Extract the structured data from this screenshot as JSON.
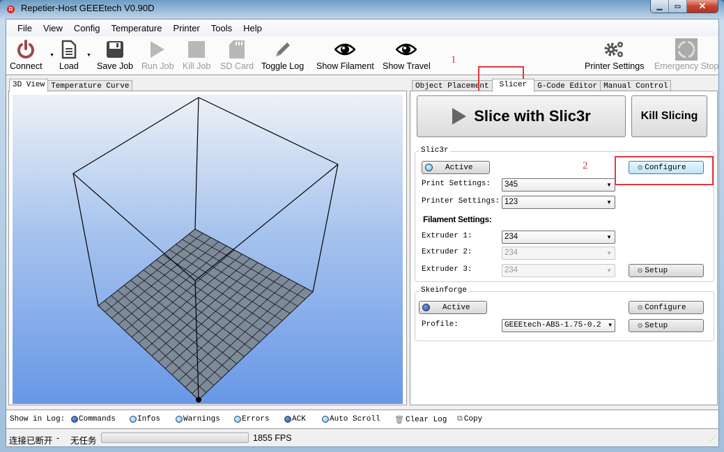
{
  "window": {
    "title": "Repetier-Host GEEEtech V0.90D",
    "app_icon": "R",
    "minimize_icon": "▁",
    "maximize_icon": "▭",
    "close_icon": "✕"
  },
  "menu": [
    "File",
    "View",
    "Config",
    "Temperature",
    "Printer",
    "Tools",
    "Help"
  ],
  "toolbar": {
    "connect": "Connect",
    "load": "Load",
    "save_job": "Save Job",
    "run_job": "Run Job",
    "kill_job": "Kill Job",
    "sd_card": "SD Card",
    "toggle_log": "Toggle Log",
    "show_filament": "Show Filament",
    "show_travel": "Show Travel",
    "printer_settings": "Printer Settings",
    "emergency_stop": "Emergency Stop",
    "dropdown_arrow": "▼"
  },
  "annotations": {
    "one": "1",
    "two": "2",
    "color": "#e0393e"
  },
  "left_tabs": [
    "3D View",
    "Temperature Curve"
  ],
  "right_tabs": [
    "Object Placement",
    "Slicer",
    "G-Code Editor",
    "Manual Control"
  ],
  "slicer": {
    "slice_button": "Slice with Slic3r",
    "kill_button": "Kill Slicing",
    "slic3r": {
      "title": "Slic3r",
      "active_label": "Active",
      "configure_label": "Configure",
      "print_settings_label": "Print Settings:",
      "print_settings_value": "345",
      "printer_settings_label": "Printer Settings:",
      "printer_settings_value": "123",
      "filament_heading": "Filament Settings:",
      "extruder1_label": "Extruder 1:",
      "extruder1_value": "234",
      "extruder2_label": "Extruder 2:",
      "extruder2_value": "234",
      "extruder3_label": "Extruder 3:",
      "extruder3_value": "234",
      "setup_label": "Setup"
    },
    "skeinforge": {
      "title": "Skeinforge",
      "active_label": "Active",
      "configure_label": "Configure",
      "profile_label": "Profile:",
      "profile_value": "GEEEtech-ABS-1.75-0.2",
      "setup_label": "Setup"
    }
  },
  "log": {
    "label": "Show in Log:",
    "commands": "Commands",
    "infos": "Infos",
    "warnings": "Warnings",
    "errors": "Errors",
    "ack": "ACK",
    "auto_scroll": "Auto Scroll",
    "clear_log": "Clear Log",
    "copy": "Copy"
  },
  "status": {
    "connection": "连接已断开",
    "separator": "-",
    "task": "无任务",
    "fps": "1855 FPS",
    "progress": 0
  },
  "view3d": {
    "bed_grid_divisions": 15
  }
}
